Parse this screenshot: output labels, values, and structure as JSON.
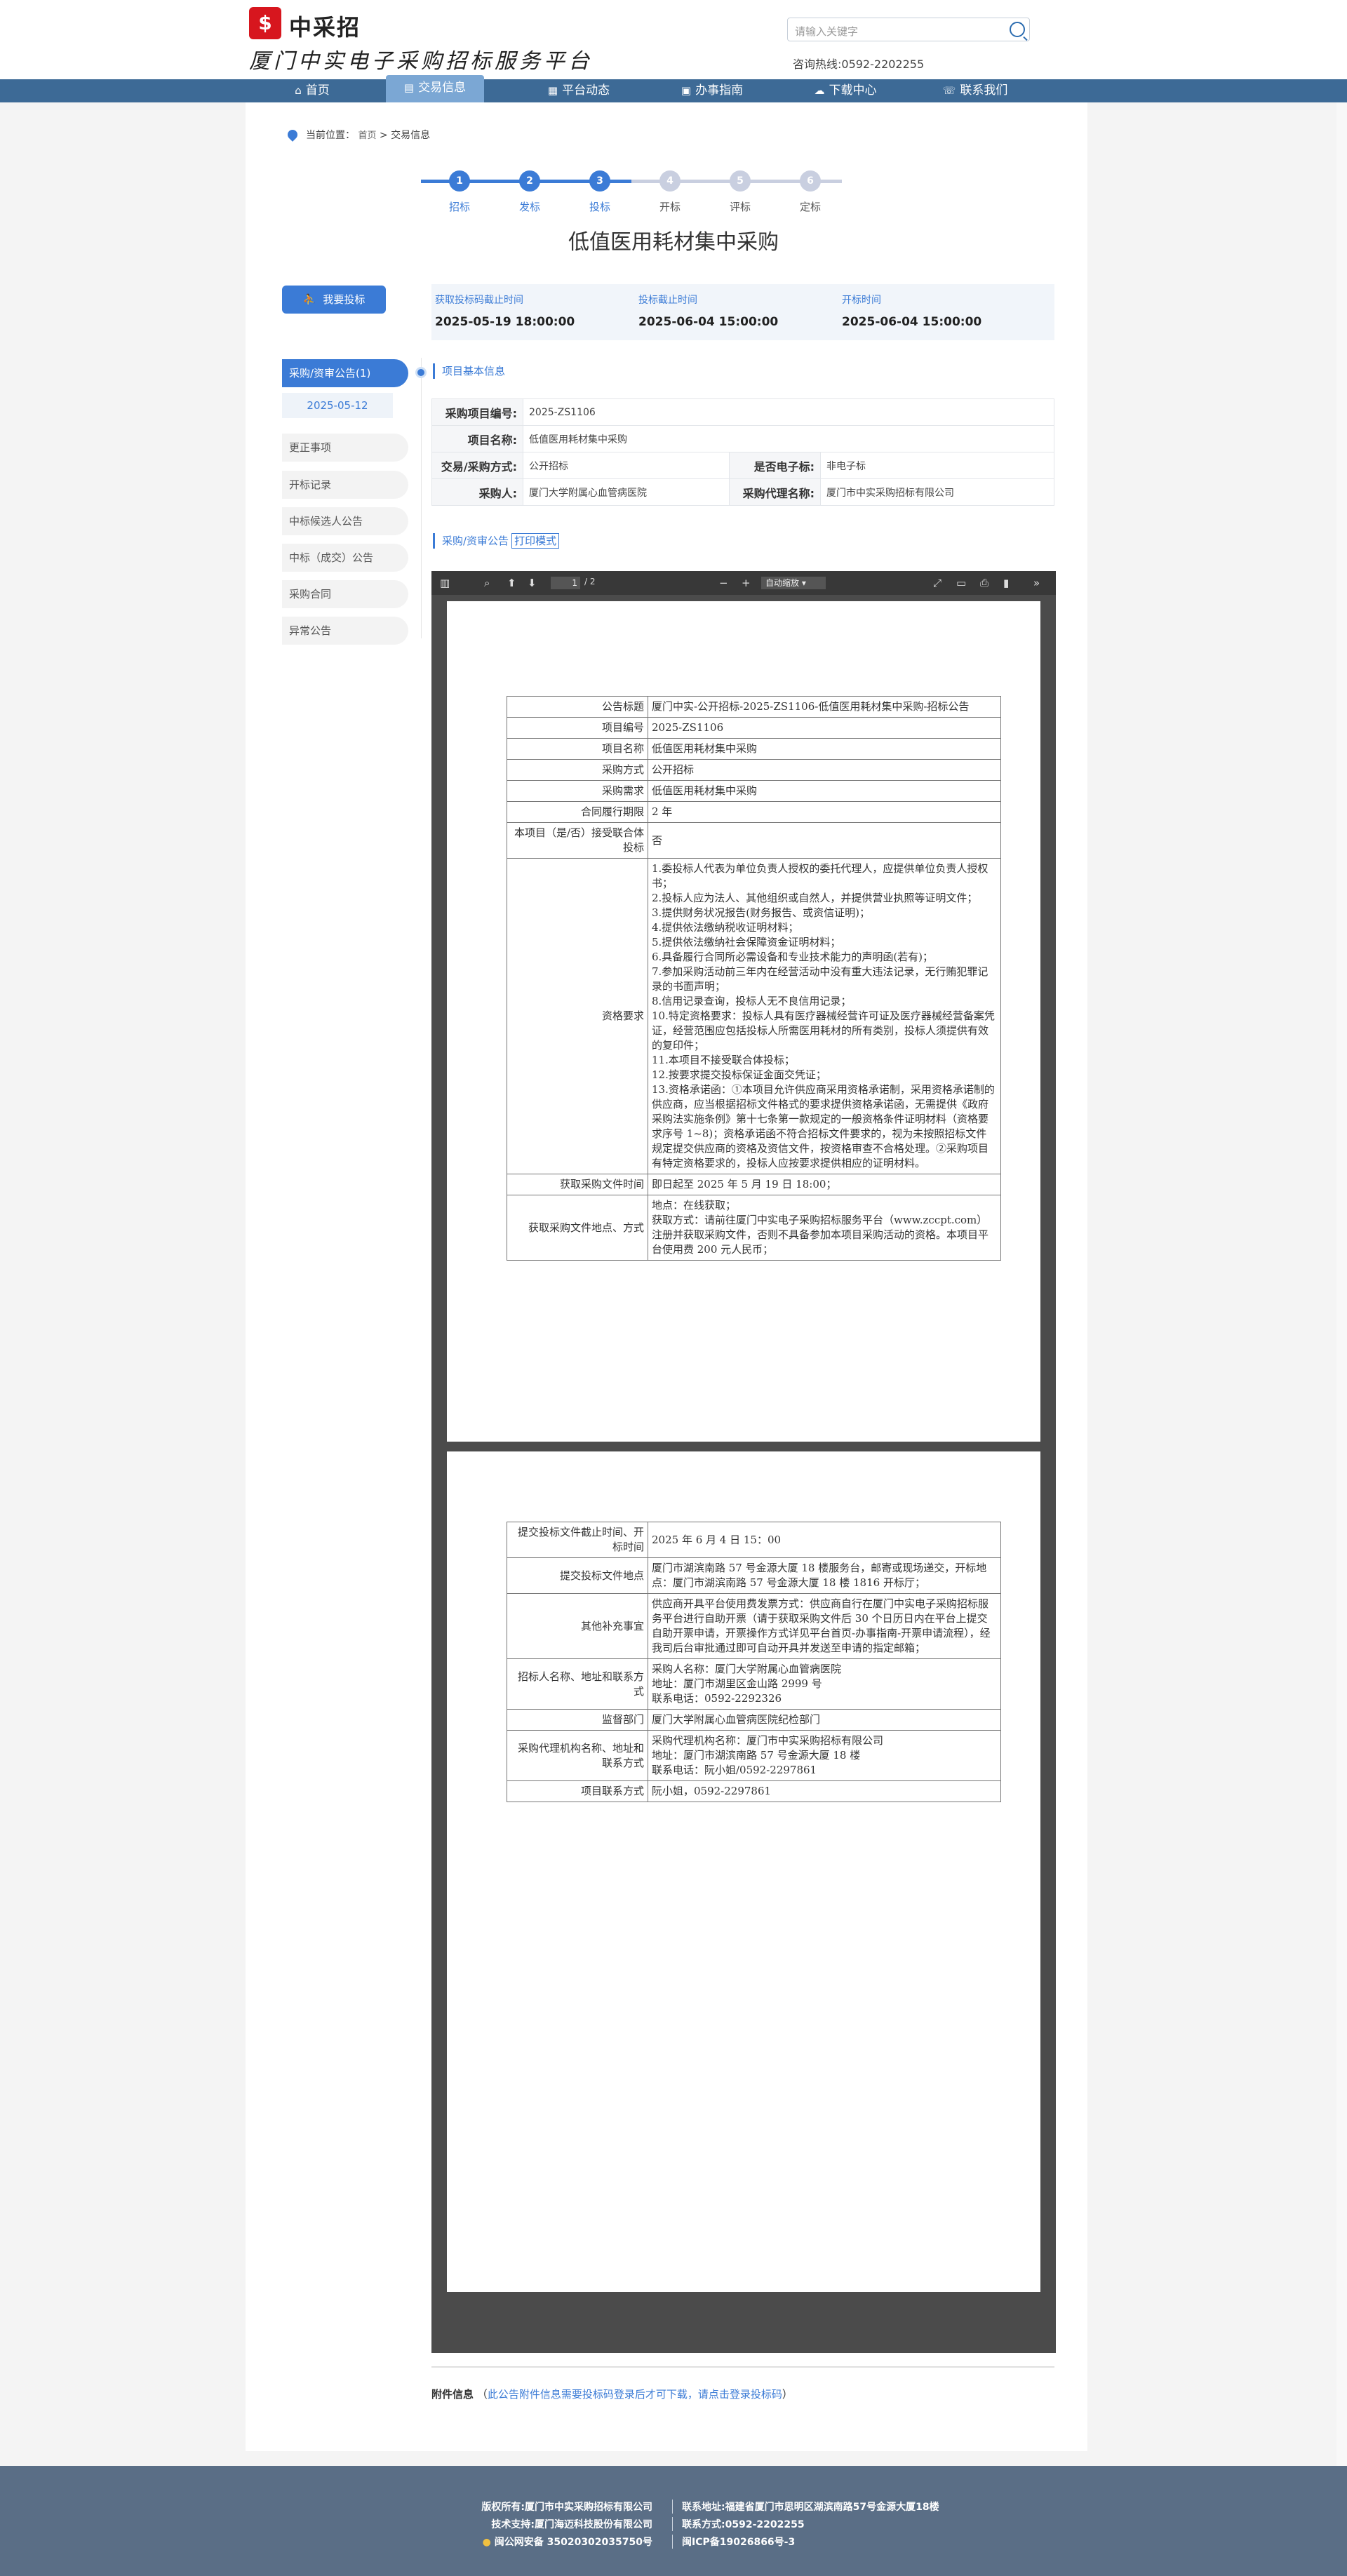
{
  "header": {
    "logo_char": "$",
    "logo_text": "中采招",
    "site_title": "厦门中实电子采购招标服务平台",
    "search_placeholder": "请输入关键字",
    "hotline": "咨询热线:0592-2202255"
  },
  "nav": [
    {
      "label": "首页",
      "icon": "home-icon",
      "glyph": "⌂"
    },
    {
      "label": "交易信息",
      "icon": "document-icon",
      "glyph": "▤",
      "active": true
    },
    {
      "label": "平台动态",
      "icon": "news-icon",
      "glyph": "▦"
    },
    {
      "label": "办事指南",
      "icon": "guide-icon",
      "glyph": "▣"
    },
    {
      "label": "下载中心",
      "icon": "cloud-download-icon",
      "glyph": "☁"
    },
    {
      "label": "联系我们",
      "icon": "headset-icon",
      "glyph": "☏"
    }
  ],
  "breadcrumb": {
    "prefix": "当前位置：",
    "home": "首页",
    "sep": ">",
    "current": "交易信息"
  },
  "steps": [
    {
      "num": "1",
      "label": "招标",
      "done": true
    },
    {
      "num": "2",
      "label": "发标",
      "done": true
    },
    {
      "num": "3",
      "label": "投标",
      "done": true
    },
    {
      "num": "4",
      "label": "开标",
      "done": false
    },
    {
      "num": "5",
      "label": "评标",
      "done": false
    },
    {
      "num": "6",
      "label": "定标",
      "done": false
    }
  ],
  "title": "低值医用耗材集中采购",
  "bid_button": "我要投标",
  "times": [
    {
      "label": "获取投标码截止时间",
      "value": "2025-05-19 18:00:00"
    },
    {
      "label": "投标截止时间",
      "value": "2025-06-04 15:00:00"
    },
    {
      "label": "开标时间",
      "value": "2025-06-04 15:00:00"
    }
  ],
  "sidebar": [
    {
      "label": "采购/资审公告(1)",
      "active": true
    },
    {
      "label": "更正事项"
    },
    {
      "label": "开标记录"
    },
    {
      "label": "中标候选人公告"
    },
    {
      "label": "中标（成交）公告"
    },
    {
      "label": "采购合同"
    },
    {
      "label": "异常公告"
    }
  ],
  "sidebar_date": "2025-05-12",
  "section_basic": "项目基本信息",
  "basic_info": {
    "code_label": "采购项目编号:",
    "code": "2025-ZS1106",
    "name_label": "项目名称:",
    "name": "低值医用耗材集中采购",
    "method_label": "交易/采购方式:",
    "method": "公开招标",
    "electronic_label": "是否电子标:",
    "electronic": "非电子标",
    "buyer_label": "采购人:",
    "buyer": "厦门大学附属心血管病医院",
    "agent_label": "采购代理名称:",
    "agent": "厦门市中实采购招标有限公司"
  },
  "section_notice": "采购/资审公告",
  "print_mode": "打印模式",
  "pdf": {
    "page": "1",
    "total": "/ 2",
    "zoom": "自动缩放",
    "page1": [
      [
        "公告标题",
        "厦门中实-公开招标-2025-ZS1106-低值医用耗材集中采购-招标公告"
      ],
      [
        "项目编号",
        "2025-ZS1106"
      ],
      [
        "项目名称",
        "低值医用耗材集中采购"
      ],
      [
        "采购方式",
        "公开招标"
      ],
      [
        "采购需求",
        "低值医用耗材集中采购"
      ],
      [
        "合同履行期限",
        "2 年"
      ],
      [
        "本项目（是/否）接受联合体投标",
        "否"
      ],
      [
        "资格要求",
        "1.委投标人代表为单位负责人授权的委托代理人，应提供单位负责人授权书；\n2.投标人应为法人、其他组织或自然人，并提供营业执照等证明文件；\n3.提供财务状况报告(财务报告、或资信证明)；\n4.提供依法缴纳税收证明材料；\n5.提供依法缴纳社会保障资金证明材料；\n6.具备履行合同所必需设备和专业技术能力的声明函(若有)；\n7.参加采购活动前三年内在经营活动中没有重大违法记录，无行贿犯罪记录的书面声明；\n8.信用记录查询，投标人无不良信用记录；\n10.特定资格要求：投标人具有医疗器械经营许可证及医疗器械经营备案凭证，经营范围应包括投标人所需医用耗材的所有类别，投标人须提供有效的复印件；\n11.本项目不接受联合体投标；\n12.按要求提交投标保证金面交凭证；\n13.资格承诺函：①本项目允许供应商采用资格承诺制，采用资格承诺制的供应商，应当根据招标文件格式的要求提供资格承诺函，无需提供《政府采购法实施条例》第十七条第一款规定的一般资格条件证明材料（资格要求序号 1~8)；资格承诺函不符合招标文件要求的，视为未按照招标文件规定提交供应商的资格及资信文件，按资格审查不合格处理。②采购项目有特定资格要求的，投标人应按要求提供相应的证明材料。"
      ],
      [
        "获取采购文件时间",
        "即日起至 2025 年 5 月 19 日 18:00；"
      ],
      [
        "获取采购文件地点、方式",
        "地点：在线获取；\n获取方式：请前往厦门中实电子采购招标服务平台（www.zccpt.com）注册并获取采购文件，否则不具备参加本项目采购活动的资格。本项目平台使用费 200 元人民币；"
      ]
    ],
    "page2": [
      [
        "提交投标文件截止时间、开标时间",
        "2025 年 6 月 4 日 15：00"
      ],
      [
        "提交投标文件地点",
        "厦门市湖滨南路 57 号金源大厦 18 楼服务台，邮寄或现场递交，开标地点：厦门市湖滨南路 57 号金源大厦 18 楼 1816 开标厅；"
      ],
      [
        "其他补充事宜",
        "供应商开具平台使用费发票方式：供应商自行在厦门中实电子采购招标服务平台进行自助开票（请于获取采购文件后 30 个日历日内在平台上提交自助开票申请，开票操作方式详见平台首页-办事指南-开票申请流程），经我司后台审批通过即可自动开具并发送至申请的指定邮箱；"
      ],
      [
        "招标人名称、地址和联系方式",
        "采购人名称：厦门大学附属心血管病医院\n地址：厦门市湖里区金山路 2999 号\n联系电话：0592-2292326"
      ],
      [
        "监督部门",
        "厦门大学附属心血管病医院纪检部门"
      ],
      [
        "采购代理机构名称、地址和联系方式",
        "采购代理机构名称：厦门市中实采购招标有限公司\n地址：厦门市湖滨南路 57 号金源大厦 18 楼\n联系电话：阮小姐/0592-2297861"
      ],
      [
        "项目联系方式",
        "阮小姐，0592-2297861"
      ]
    ]
  },
  "attachment": {
    "label": "附件信息",
    "open": "（",
    "link": "此公告附件信息需要投标码登录后才可下载，请点击登录投标码",
    "close": "）"
  },
  "footer": {
    "copyright": "版权所有:厦门市中实采购招标有限公司",
    "address": "联系地址:福建省厦门市思明区湖滨南路57号金源大厦18楼",
    "support": "技术支持:厦门海迈科技股份有限公司",
    "phone": "联系方式:0592-2202255",
    "police": "闽公网安备 35020302035750号",
    "icp": "闽ICP备19026866号-3"
  },
  "colors": {
    "primary": "#3b7bd6",
    "nav": "#3d6a96",
    "footer": "#5a6e86",
    "step_pending": "#c9cfe0"
  }
}
